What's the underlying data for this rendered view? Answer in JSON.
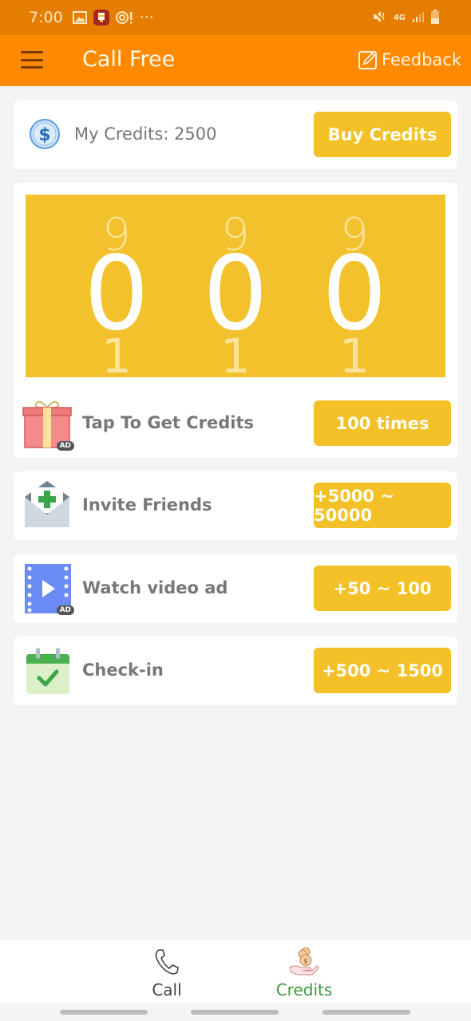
{
  "status_bar": {
    "time": "7:00",
    "icons_left": [
      "image-icon",
      "app-notification-icon",
      "alert-icon",
      "more-dots-icon"
    ],
    "network": "4G",
    "icons_right": [
      "mute-icon",
      "4g-icon",
      "signal-icon",
      "battery-icon"
    ],
    "more": "···"
  },
  "app_bar": {
    "title": "Call Free",
    "feedback_label": "Feedback"
  },
  "credits": {
    "label": "My Credits: 2500",
    "value": 2500,
    "buy_label": "Buy Credits"
  },
  "slot_machine": {
    "reels": [
      {
        "prev": "9",
        "current": "0",
        "next": "1"
      },
      {
        "prev": "9",
        "current": "0",
        "next": "1"
      },
      {
        "prev": "9",
        "current": "0",
        "next": "1"
      }
    ]
  },
  "tasks": [
    {
      "label": "Tap To Get Credits",
      "button": "100 times",
      "icon": "gift-icon",
      "ad": "AD"
    },
    {
      "label": "Invite Friends",
      "button": "+5000 ~ 50000",
      "icon": "envelope-plus-icon"
    },
    {
      "label": "Watch video ad",
      "button": "+50 ~ 100",
      "icon": "video-play-icon",
      "ad": "AD"
    },
    {
      "label": "Check-in",
      "button": "+500 ~ 1500",
      "icon": "calendar-check-icon"
    }
  ],
  "bottom_nav": {
    "items": [
      {
        "label": "Call",
        "icon": "phone-icon",
        "active": false
      },
      {
        "label": "Credits",
        "icon": "hand-coins-icon",
        "active": true
      }
    ]
  },
  "colors": {
    "status_bar": "#e47d00",
    "app_bar": "#ff8a00",
    "button": "#f3c027",
    "slot_bg": "#f2c12c",
    "active_nav": "#3d9a3d"
  }
}
